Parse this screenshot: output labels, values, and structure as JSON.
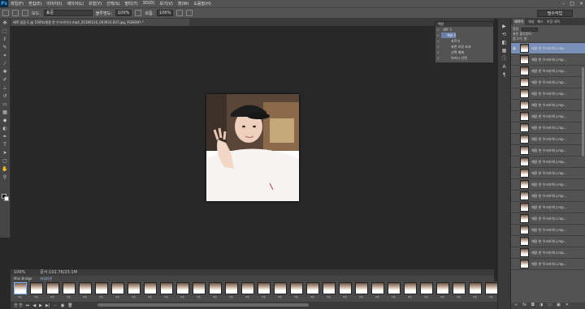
{
  "app": {
    "logo": "Ps"
  },
  "menubar": {
    "items": [
      "파일(F)",
      "편집(E)",
      "이미지(I)",
      "레이어(L)",
      "유형(Y)",
      "선택(S)",
      "필터(T)",
      "3D(D)",
      "보기(V)",
      "창(W)",
      "도움말(H)"
    ]
  },
  "options": {
    "mode_label": "모드:",
    "mode_value": "표준",
    "opacity_label": "불투명도:",
    "opacity_value": "100%",
    "flow_label": "흐름:",
    "flow_value": "100%"
  },
  "workspace": {
    "value": "필수작업"
  },
  "document_tab": {
    "title": "제목 없음-1 @ 100%(채용 한 우크라이나.mp4_20180120_003933.837.jpg, RGB/8#) *"
  },
  "status": {
    "zoom": "100%",
    "doc_size": "문서:102.7K/23.1M"
  },
  "timeline": {
    "tabs": [
      "Mini Bridge",
      "타임라인"
    ],
    "frame_times": [
      "0초",
      "0초",
      "0초",
      "0초",
      "0초",
      "0초",
      "0초",
      "0초",
      "0초",
      "0초",
      "0초",
      "0초",
      "0초",
      "0초",
      "0초",
      "0초",
      "0초",
      "0초",
      "0초",
      "0초",
      "0초",
      "0초",
      "0초",
      "0초",
      "0초",
      "0초",
      "0초",
      "0초",
      "0초",
      "0초",
      "0초"
    ],
    "loop": "한 번"
  },
  "actions": {
    "title": "액션",
    "rows": [
      {
        "label": "세트 1",
        "selected": false
      },
      {
        "label": "액션 1",
        "selected": true
      },
      {
        "label": "자르기",
        "selected": false
      },
      {
        "label": "표면 흐림 효과",
        "selected": false
      },
      {
        "label": "선택 해제",
        "selected": false
      },
      {
        "label": "브러시 선택",
        "selected": false
      }
    ]
  },
  "layers_panel": {
    "tabs": [
      "레이어",
      "채널",
      "패스",
      "저장 내역"
    ],
    "kind_label": "종류",
    "kind_value": "종류",
    "blend_value": "표준",
    "opacity_label": "불투명도:",
    "lock_label": "잠그기:",
    "fill_label": "칠:",
    "layer_names": [
      "채용 한 우크라이나.mp...",
      "채용 한 우크라이나.mp...",
      "채용 한 우크라이나.mp...",
      "채용 한 우크라이나.mp...",
      "채용 한 우크라이나.mp...",
      "채용 한 우크라이나.mp...",
      "채용 한 우크라이나.mp...",
      "채용 한 우크라이나.mp...",
      "채용 한 우크라이나.mp...",
      "채용 한 우크라이나.mp...",
      "채용 한 우크라이나.mp...",
      "채용 한 우크라이나.mp...",
      "채용 한 우크라이나.mp...",
      "채용 한 우크라이나.mp...",
      "채용 한 우크라이나.mp...",
      "채용 한 우크라이나.mp...",
      "채용 한 우크라이나.mp...",
      "채용 한 우크라이나.mp...",
      "채용 한 우크라이나.mp...",
      "채용 한 우크라이나.mp..."
    ]
  }
}
